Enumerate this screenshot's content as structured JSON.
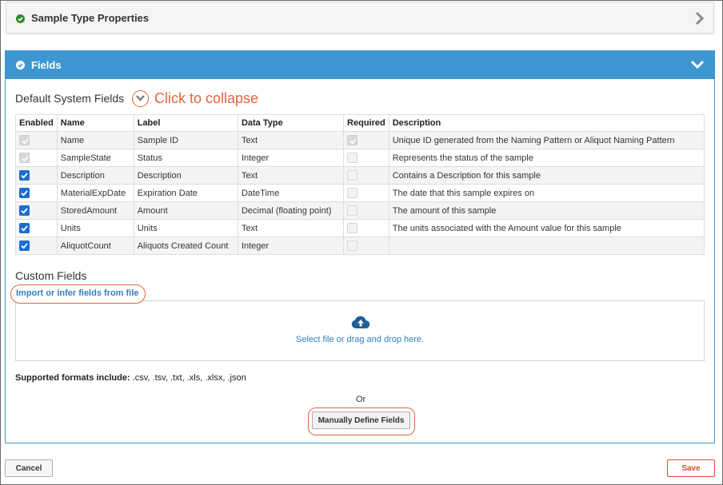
{
  "sample_type_panel": {
    "title": "Sample Type Properties"
  },
  "fields_panel": {
    "title": "Fields"
  },
  "system_fields": {
    "title": "Default System Fields",
    "annotation": "Click to collapse",
    "columns": [
      "Enabled",
      "Name",
      "Label",
      "Data Type",
      "Required",
      "Description"
    ],
    "rows": [
      {
        "enabled": "checked-disabled",
        "name": "Name",
        "label": "Sample ID",
        "data_type": "Text",
        "required": "checked-disabled",
        "description": "Unique ID generated from the Naming Pattern or Aliquot Naming Pattern"
      },
      {
        "enabled": "checked-disabled",
        "name": "SampleState",
        "label": "Status",
        "data_type": "Integer",
        "required": "unchecked",
        "description": "Represents the status of the sample"
      },
      {
        "enabled": "checked",
        "name": "Description",
        "label": "Description",
        "data_type": "Text",
        "required": "unchecked",
        "description": "Contains a Description for this sample"
      },
      {
        "enabled": "checked",
        "name": "MaterialExpDate",
        "label": "Expiration Date",
        "data_type": "DateTime",
        "required": "unchecked",
        "description": "The date that this sample expires on"
      },
      {
        "enabled": "checked",
        "name": "StoredAmount",
        "label": "Amount",
        "data_type": "Decimal (floating point)",
        "required": "unchecked",
        "description": "The amount of this sample"
      },
      {
        "enabled": "checked",
        "name": "Units",
        "label": "Units",
        "data_type": "Text",
        "required": "unchecked",
        "description": "The units associated with the Amount value for this sample"
      },
      {
        "enabled": "checked",
        "name": "AliquotCount",
        "label": "Aliquots Created Count",
        "data_type": "Integer",
        "required": "unchecked",
        "description": ""
      }
    ]
  },
  "custom_fields": {
    "title": "Custom Fields",
    "import_link": "Import or infer fields from file",
    "dropzone_text": "Select file or drag and drop here.",
    "formats_label": "Supported formats include:",
    "formats": ".csv, .tsv, .txt, .xls, .xlsx, .json",
    "or_text": "Or",
    "manual_button": "Manually Define Fields"
  },
  "footer": {
    "cancel_label": "Cancel",
    "save_label": "Save"
  },
  "colors": {
    "accent": "#3e97d1",
    "annotation": "#e0663a",
    "checkbox": "#1c6dd0",
    "success": "#2e8b2e",
    "save": "#d94f2b"
  },
  "icons": [
    "check-circle-icon",
    "chevron-right-icon",
    "chevron-down-icon",
    "cloud-upload-icon",
    "checkbox-icon"
  ]
}
